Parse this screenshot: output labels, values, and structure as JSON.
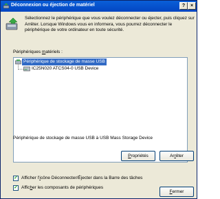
{
  "window": {
    "title": "Déconnexion ou éjection de matériel",
    "help_glyph": "?",
    "close_glyph": "×"
  },
  "intro": {
    "text": "Sélectionnez le périphérique que vous voulez déconnecter ou éjecter, puis cliquez sur Arrêter. Lorsque Windows vous en informera, vous pourrez déconnecter le périphérique de votre ordinateur en toute sécurité."
  },
  "devices_label": {
    "pre": "Périphériques ",
    "accel": "m",
    "post": "atériels :"
  },
  "tree": {
    "items": [
      {
        "label": "Périphérique de stockage de masse USB",
        "selected": true
      },
      {
        "label": "IC25N020 ATCS04-0 USB Device",
        "selected": false
      }
    ]
  },
  "description": "Périphérique de stockage de masse USB à USB Mass Storage Device",
  "buttons": {
    "properties": {
      "accel": "P",
      "rest": "ropriétés"
    },
    "stop": {
      "pre": "Ar",
      "accel": "r",
      "post": "êter"
    },
    "close": {
      "accel": "F",
      "rest": "ermer"
    }
  },
  "checkboxes": {
    "show_icon": {
      "pre": "Afficher l'",
      "accel": "i",
      "post": "cône Déconnecter/Éjecter dans la Barre des tâches",
      "checked": "✓"
    },
    "show_components": {
      "pre": "Affic",
      "accel": "h",
      "post": "er les composants de périphériques",
      "checked": "✓"
    }
  }
}
